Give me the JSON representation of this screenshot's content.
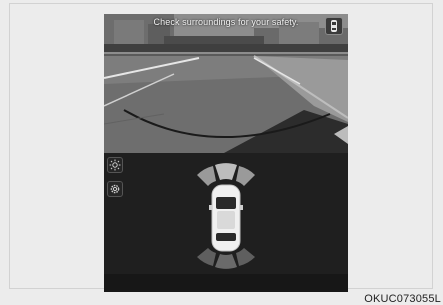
{
  "camera": {
    "warning_text": "Check surroundings for your safety."
  },
  "figure": {
    "code": "OKUC073055L"
  },
  "icons": {
    "view_toggle": "car-top-view-icon",
    "brightness": "brightness-icon",
    "settings": "gear-icon"
  }
}
